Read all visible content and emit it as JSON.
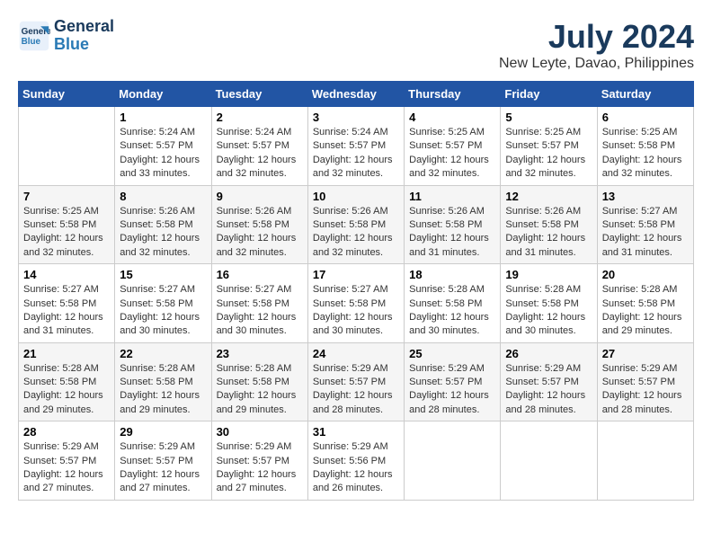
{
  "header": {
    "logo_line1": "General",
    "logo_line2": "Blue",
    "month_year": "July 2024",
    "location": "New Leyte, Davao, Philippines"
  },
  "days_of_week": [
    "Sunday",
    "Monday",
    "Tuesday",
    "Wednesday",
    "Thursday",
    "Friday",
    "Saturday"
  ],
  "weeks": [
    [
      {
        "num": "",
        "sunrise": "",
        "sunset": "",
        "daylight": ""
      },
      {
        "num": "1",
        "sunrise": "Sunrise: 5:24 AM",
        "sunset": "Sunset: 5:57 PM",
        "daylight": "Daylight: 12 hours and 33 minutes."
      },
      {
        "num": "2",
        "sunrise": "Sunrise: 5:24 AM",
        "sunset": "Sunset: 5:57 PM",
        "daylight": "Daylight: 12 hours and 32 minutes."
      },
      {
        "num": "3",
        "sunrise": "Sunrise: 5:24 AM",
        "sunset": "Sunset: 5:57 PM",
        "daylight": "Daylight: 12 hours and 32 minutes."
      },
      {
        "num": "4",
        "sunrise": "Sunrise: 5:25 AM",
        "sunset": "Sunset: 5:57 PM",
        "daylight": "Daylight: 12 hours and 32 minutes."
      },
      {
        "num": "5",
        "sunrise": "Sunrise: 5:25 AM",
        "sunset": "Sunset: 5:57 PM",
        "daylight": "Daylight: 12 hours and 32 minutes."
      },
      {
        "num": "6",
        "sunrise": "Sunrise: 5:25 AM",
        "sunset": "Sunset: 5:58 PM",
        "daylight": "Daylight: 12 hours and 32 minutes."
      }
    ],
    [
      {
        "num": "7",
        "sunrise": "Sunrise: 5:25 AM",
        "sunset": "Sunset: 5:58 PM",
        "daylight": "Daylight: 12 hours and 32 minutes."
      },
      {
        "num": "8",
        "sunrise": "Sunrise: 5:26 AM",
        "sunset": "Sunset: 5:58 PM",
        "daylight": "Daylight: 12 hours and 32 minutes."
      },
      {
        "num": "9",
        "sunrise": "Sunrise: 5:26 AM",
        "sunset": "Sunset: 5:58 PM",
        "daylight": "Daylight: 12 hours and 32 minutes."
      },
      {
        "num": "10",
        "sunrise": "Sunrise: 5:26 AM",
        "sunset": "Sunset: 5:58 PM",
        "daylight": "Daylight: 12 hours and 32 minutes."
      },
      {
        "num": "11",
        "sunrise": "Sunrise: 5:26 AM",
        "sunset": "Sunset: 5:58 PM",
        "daylight": "Daylight: 12 hours and 31 minutes."
      },
      {
        "num": "12",
        "sunrise": "Sunrise: 5:26 AM",
        "sunset": "Sunset: 5:58 PM",
        "daylight": "Daylight: 12 hours and 31 minutes."
      },
      {
        "num": "13",
        "sunrise": "Sunrise: 5:27 AM",
        "sunset": "Sunset: 5:58 PM",
        "daylight": "Daylight: 12 hours and 31 minutes."
      }
    ],
    [
      {
        "num": "14",
        "sunrise": "Sunrise: 5:27 AM",
        "sunset": "Sunset: 5:58 PM",
        "daylight": "Daylight: 12 hours and 31 minutes."
      },
      {
        "num": "15",
        "sunrise": "Sunrise: 5:27 AM",
        "sunset": "Sunset: 5:58 PM",
        "daylight": "Daylight: 12 hours and 30 minutes."
      },
      {
        "num": "16",
        "sunrise": "Sunrise: 5:27 AM",
        "sunset": "Sunset: 5:58 PM",
        "daylight": "Daylight: 12 hours and 30 minutes."
      },
      {
        "num": "17",
        "sunrise": "Sunrise: 5:27 AM",
        "sunset": "Sunset: 5:58 PM",
        "daylight": "Daylight: 12 hours and 30 minutes."
      },
      {
        "num": "18",
        "sunrise": "Sunrise: 5:28 AM",
        "sunset": "Sunset: 5:58 PM",
        "daylight": "Daylight: 12 hours and 30 minutes."
      },
      {
        "num": "19",
        "sunrise": "Sunrise: 5:28 AM",
        "sunset": "Sunset: 5:58 PM",
        "daylight": "Daylight: 12 hours and 30 minutes."
      },
      {
        "num": "20",
        "sunrise": "Sunrise: 5:28 AM",
        "sunset": "Sunset: 5:58 PM",
        "daylight": "Daylight: 12 hours and 29 minutes."
      }
    ],
    [
      {
        "num": "21",
        "sunrise": "Sunrise: 5:28 AM",
        "sunset": "Sunset: 5:58 PM",
        "daylight": "Daylight: 12 hours and 29 minutes."
      },
      {
        "num": "22",
        "sunrise": "Sunrise: 5:28 AM",
        "sunset": "Sunset: 5:58 PM",
        "daylight": "Daylight: 12 hours and 29 minutes."
      },
      {
        "num": "23",
        "sunrise": "Sunrise: 5:28 AM",
        "sunset": "Sunset: 5:58 PM",
        "daylight": "Daylight: 12 hours and 29 minutes."
      },
      {
        "num": "24",
        "sunrise": "Sunrise: 5:29 AM",
        "sunset": "Sunset: 5:57 PM",
        "daylight": "Daylight: 12 hours and 28 minutes."
      },
      {
        "num": "25",
        "sunrise": "Sunrise: 5:29 AM",
        "sunset": "Sunset: 5:57 PM",
        "daylight": "Daylight: 12 hours and 28 minutes."
      },
      {
        "num": "26",
        "sunrise": "Sunrise: 5:29 AM",
        "sunset": "Sunset: 5:57 PM",
        "daylight": "Daylight: 12 hours and 28 minutes."
      },
      {
        "num": "27",
        "sunrise": "Sunrise: 5:29 AM",
        "sunset": "Sunset: 5:57 PM",
        "daylight": "Daylight: 12 hours and 28 minutes."
      }
    ],
    [
      {
        "num": "28",
        "sunrise": "Sunrise: 5:29 AM",
        "sunset": "Sunset: 5:57 PM",
        "daylight": "Daylight: 12 hours and 27 minutes."
      },
      {
        "num": "29",
        "sunrise": "Sunrise: 5:29 AM",
        "sunset": "Sunset: 5:57 PM",
        "daylight": "Daylight: 12 hours and 27 minutes."
      },
      {
        "num": "30",
        "sunrise": "Sunrise: 5:29 AM",
        "sunset": "Sunset: 5:57 PM",
        "daylight": "Daylight: 12 hours and 27 minutes."
      },
      {
        "num": "31",
        "sunrise": "Sunrise: 5:29 AM",
        "sunset": "Sunset: 5:56 PM",
        "daylight": "Daylight: 12 hours and 26 minutes."
      },
      {
        "num": "",
        "sunrise": "",
        "sunset": "",
        "daylight": ""
      },
      {
        "num": "",
        "sunrise": "",
        "sunset": "",
        "daylight": ""
      },
      {
        "num": "",
        "sunrise": "",
        "sunset": "",
        "daylight": ""
      }
    ]
  ]
}
